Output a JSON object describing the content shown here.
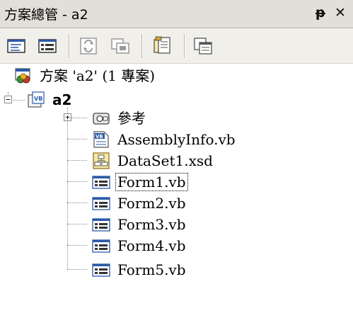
{
  "window": {
    "title": "方案總管 - a2",
    "pin_glyph": "ᵽ",
    "close_glyph": "✕"
  },
  "toolbar": {
    "buttons": [
      {
        "name": "view-code-icon"
      },
      {
        "name": "view-designer-icon"
      },
      {
        "name": "refresh-icon"
      },
      {
        "name": "show-all-files-icon"
      },
      {
        "name": "properties-icon"
      },
      {
        "name": "copy-project-icon"
      }
    ]
  },
  "tree": {
    "solution": {
      "label": "方案 'a2' (1 專案)"
    },
    "project": {
      "label": "a2",
      "expander": "−"
    },
    "references": {
      "label": "參考",
      "expander": "+"
    },
    "items": [
      {
        "label": "AssemblyInfo.vb",
        "icon": "vb-file-icon"
      },
      {
        "label": "DataSet1.xsd",
        "icon": "dataset-icon"
      },
      {
        "label": "Form1.vb",
        "icon": "form-icon",
        "selected": true
      },
      {
        "label": "Form2.vb",
        "icon": "form-icon"
      },
      {
        "label": "Form3.vb",
        "icon": "form-icon"
      },
      {
        "label": "Form4.vb",
        "icon": "form-icon"
      },
      {
        "label": "Form5.vb",
        "icon": "form-icon"
      }
    ]
  },
  "colors": {
    "titlebar": "#e2dfd8",
    "toolbar": "#f1efe9",
    "form_icon_blue": "#2b59a8"
  }
}
